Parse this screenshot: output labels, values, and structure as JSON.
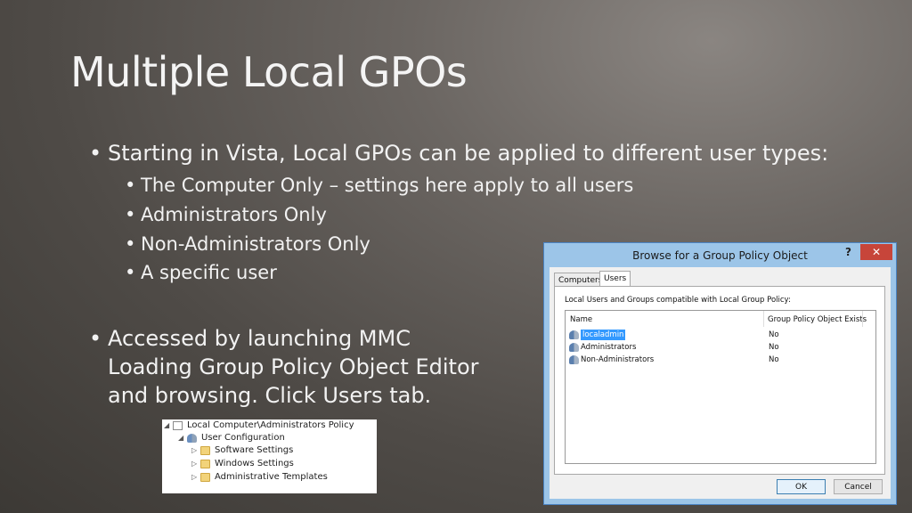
{
  "slide": {
    "title": "Multiple Local GPOs",
    "bullets": [
      "Starting in Vista, Local GPOs can be applied to different user types:",
      "The Computer Only – settings here apply to all users",
      "Administrators Only",
      "Non-Administrators Only",
      "A specific user",
      "Accessed by launching MMC",
      "Loading Group Policy Object Editor",
      "and browsing. Click Users tab."
    ],
    "bullet_glyph": "•"
  },
  "tree": {
    "items": [
      "Local Computer\\Administrators Policy",
      "User Configuration",
      "Software Settings",
      "Windows Settings",
      "Administrative Templates"
    ],
    "expanded_glyph": "◢",
    "collapsed_glyph": "▷"
  },
  "dialog": {
    "title": "Browse for a Group Policy Object",
    "help": "?",
    "close": "✕",
    "tabs": [
      "Computers",
      "Users"
    ],
    "active_tab": "Users",
    "description": "Local Users and Groups compatible with Local Group Policy:",
    "columns": [
      "Name",
      "Group Policy Object Exists"
    ],
    "rows": [
      {
        "name": "localadmin",
        "exists": "No",
        "selected": true
      },
      {
        "name": "Administrators",
        "exists": "No",
        "selected": false
      },
      {
        "name": "Non-Administrators",
        "exists": "No",
        "selected": false
      }
    ],
    "ok_label": "OK",
    "cancel_label": "Cancel",
    "accent_color": "#3399ff",
    "close_color": "#c7453a"
  }
}
